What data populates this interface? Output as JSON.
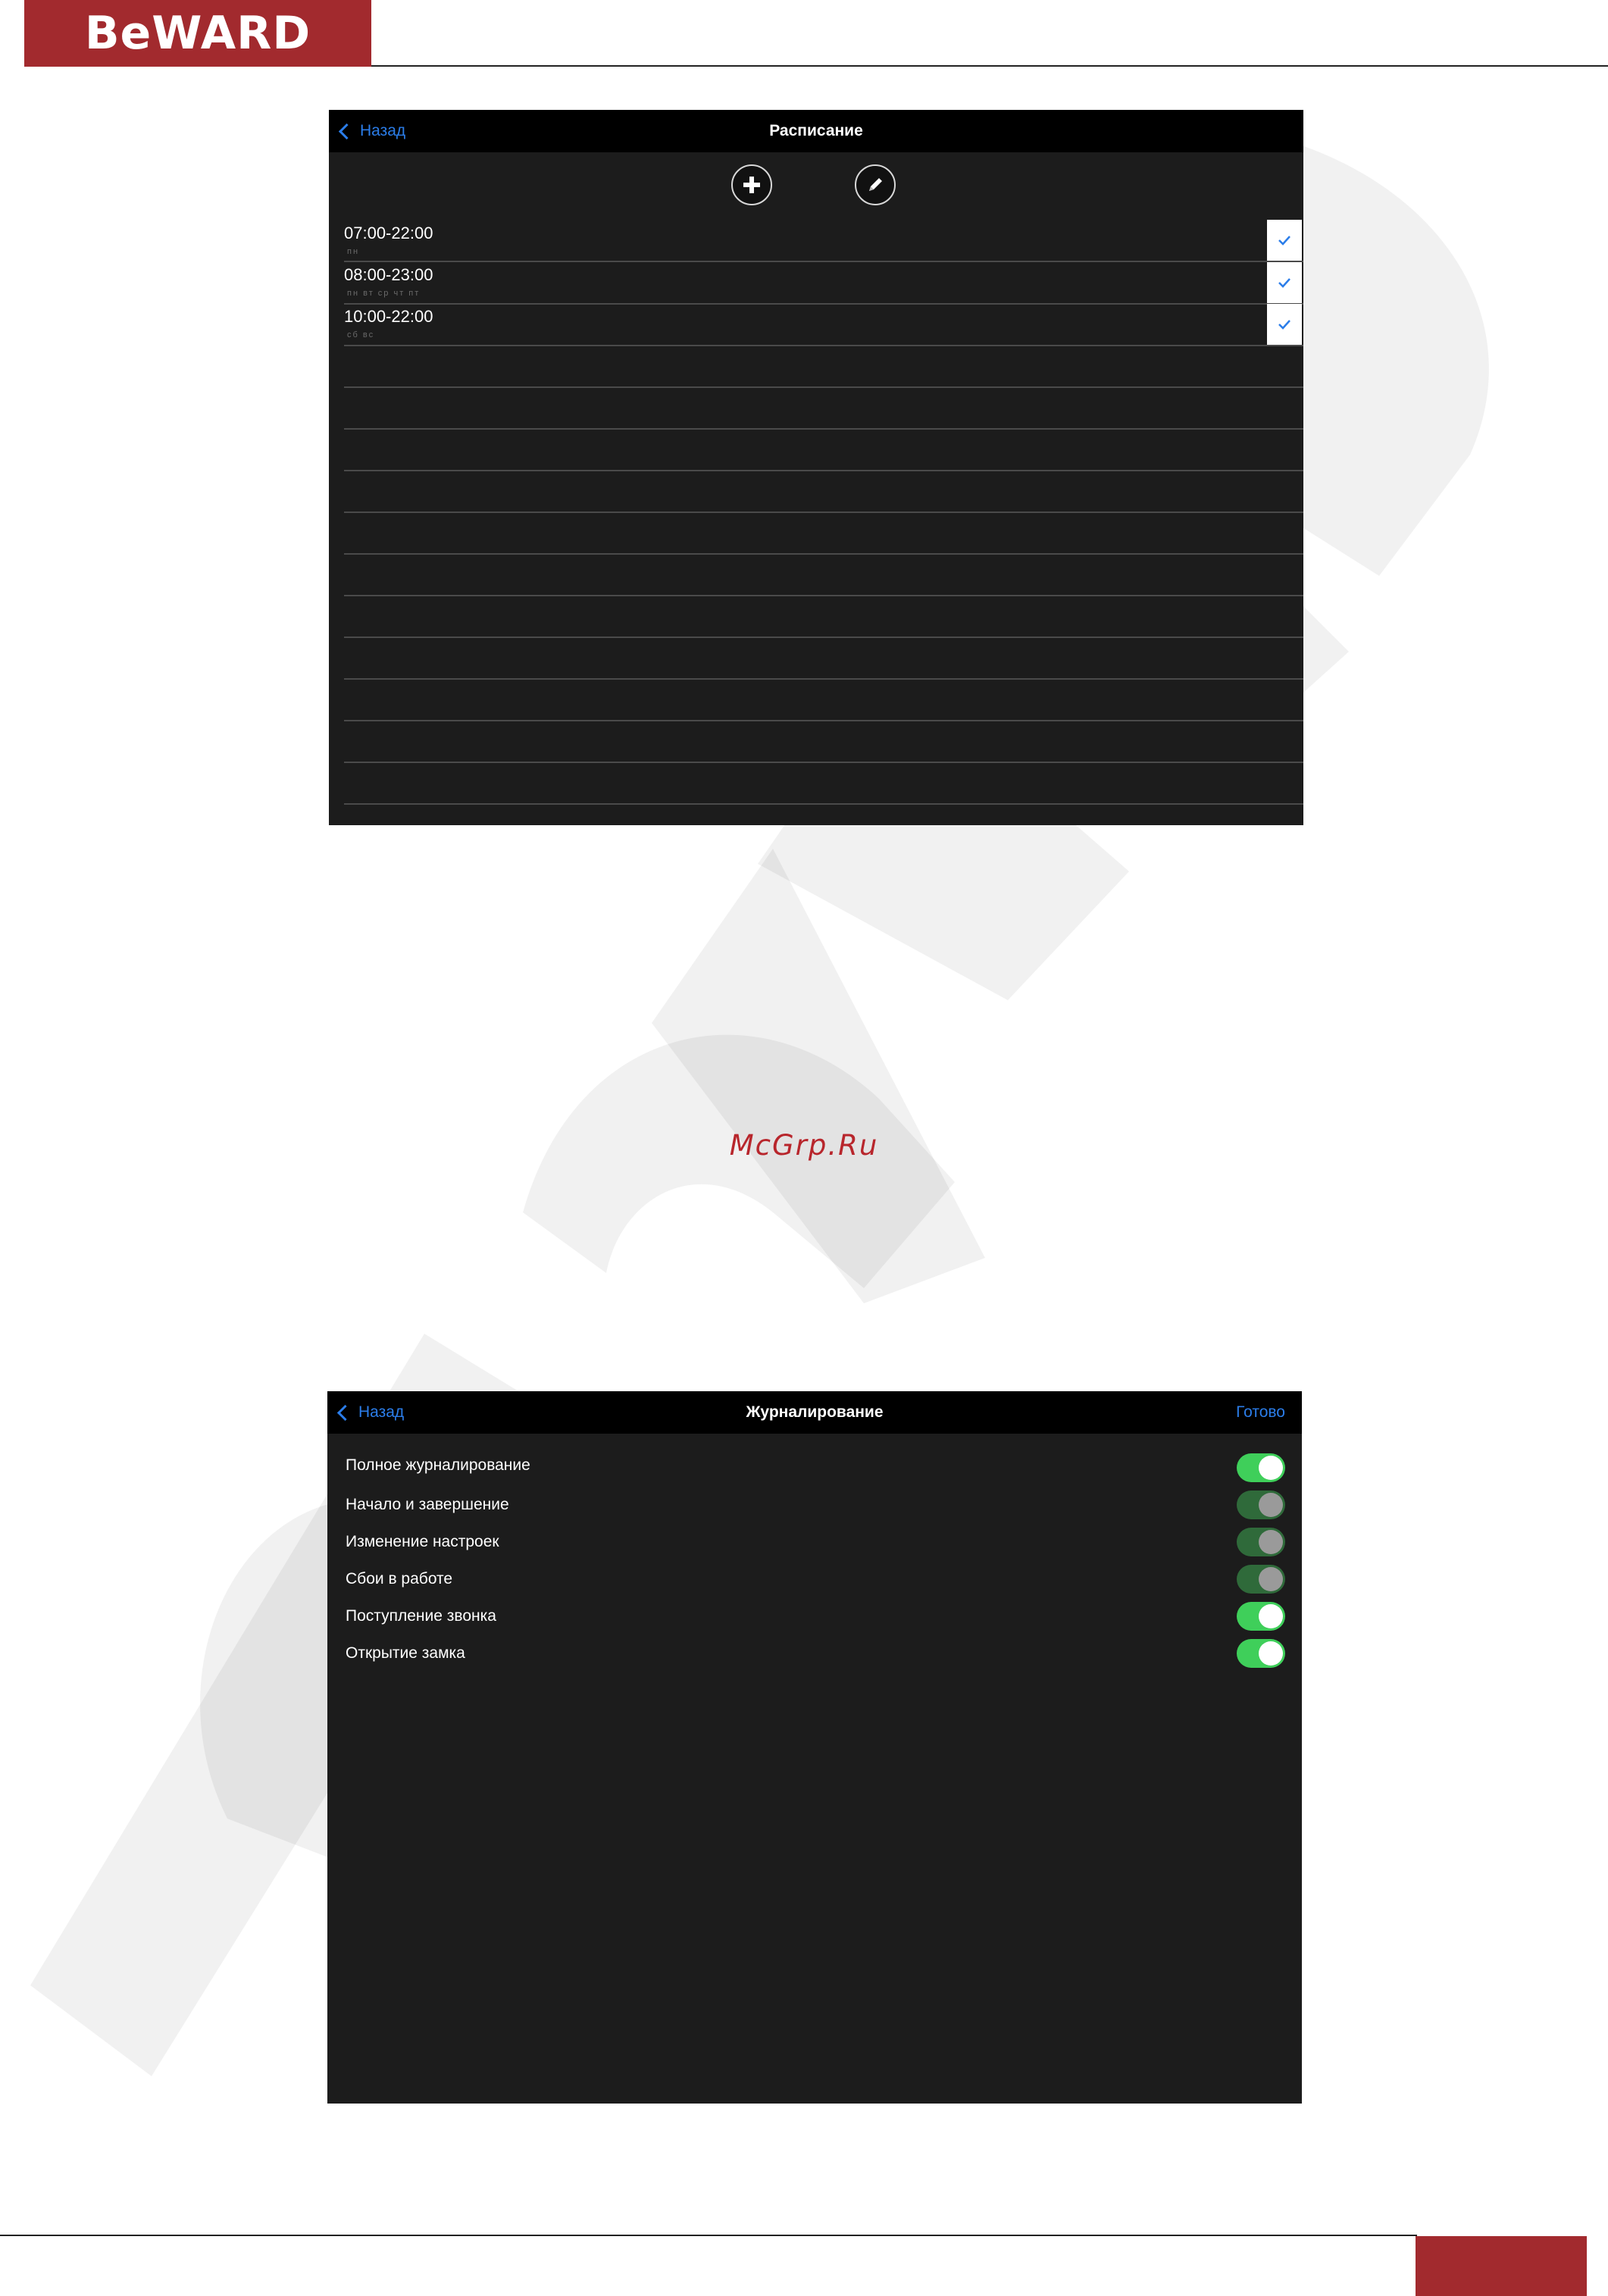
{
  "header": {
    "logo_text": "BeWARD",
    "brand_color": "#a22a2e"
  },
  "center_link": "McGrp.Ru",
  "schedule_screen": {
    "back_label": "Назад",
    "title": "Расписание",
    "icons": [
      "plus-icon",
      "pencil-icon"
    ],
    "rows": [
      {
        "time": "07:00-22:00",
        "days": "пн",
        "checked": true
      },
      {
        "time": "08:00-23:00",
        "days": "пн вт ср чт пт",
        "checked": true
      },
      {
        "time": "10:00-22:00",
        "days": "сб вс",
        "checked": true
      }
    ]
  },
  "logging_screen": {
    "back_label": "Назад",
    "title": "Журналирование",
    "done_label": "Готово",
    "items": [
      {
        "label": "Полное журналирование",
        "state": "on"
      },
      {
        "label": "Начало и завершение",
        "state": "dim"
      },
      {
        "label": "Изменение настроек",
        "state": "dim"
      },
      {
        "label": "Сбои в работе",
        "state": "dim"
      },
      {
        "label": "Поступление звонка",
        "state": "on"
      },
      {
        "label": "Открытие замка",
        "state": "on"
      }
    ]
  },
  "colors": {
    "accent": "#2b7de9",
    "toggle_on": "#3fcf5a",
    "screen_bg": "#1c1c1c"
  }
}
